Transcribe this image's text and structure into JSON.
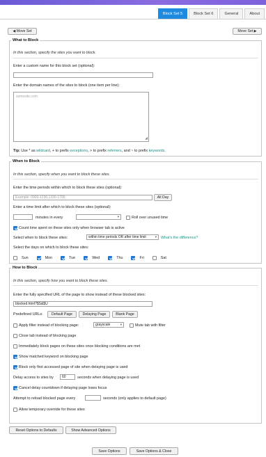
{
  "tabs": [
    "Block Set 5",
    "Block Set 6",
    "General",
    "About"
  ],
  "nav": {
    "move_left": "◀ Move Set",
    "move_right": "Move Set ▶"
  },
  "what": {
    "legend": "What to Block",
    "hint": "In this section, specify the sites you want to block.",
    "custom_name_label": "Enter a custom name for this block set (optional):",
    "custom_name_value": "",
    "domains_label": "Enter the domain names of the sites to block (one item per line):",
    "domains_placeholder": "somesite.com",
    "tip_pre": "Tip: Use * as ",
    "tip_wildcard": "wildcard",
    "tip_mid1": ", + to prefix ",
    "tip_exceptions": "exceptions",
    "tip_mid2": ", > to prefix ",
    "tip_referrers": "referrers",
    "tip_mid3": ", and ~ to prefix ",
    "tip_keywords": "keywords",
    "tip_end": "."
  },
  "when": {
    "legend": "When to Block",
    "hint": "In this section, specify when you want to block these sites.",
    "periods_label": "Enter the time periods within which to block these sites (optional):",
    "periods_placeholder": "Example: 0900-1230,1330-1700",
    "all_day": "All Day",
    "limit_label": "Enter a time limit after which to block these sites (optional):",
    "minutes_in_every": "minutes in every",
    "rollover": "Roll over unused time",
    "count_time": "Count time spent on these sites only when browser tab is active",
    "select_when_label": "Select when to block these sites:",
    "select_when_value": "within time periods OR after time limit",
    "whats_diff": "What's the difference?",
    "days_label": "Select the days on which to block these sites:",
    "days": [
      {
        "label": "Sun",
        "on": false
      },
      {
        "label": "Mon",
        "on": true
      },
      {
        "label": "Tue",
        "on": true
      },
      {
        "label": "Wed",
        "on": true
      },
      {
        "label": "Thu",
        "on": true
      },
      {
        "label": "Fri",
        "on": true
      },
      {
        "label": "Sat",
        "on": false
      }
    ]
  },
  "how": {
    "legend": "How to Block",
    "hint": "In this section, specify how you want to block these sites.",
    "url_label": "Enter the fully specified URL of the page to show instead of these blocked sites:",
    "url_value": "blocked.html?$S&$U",
    "predefined_label": "Predefined URLs:",
    "predefined": [
      "Default Page",
      "Delaying Page",
      "Blank Page"
    ],
    "apply_filter": "Apply filter instead of blocking page:",
    "filter_value": "grayscale",
    "mute_tab": "Mute tab with filter",
    "close_tab": "Close tab instead of blocking page",
    "immediately": "Immediately block pages on these sites once blocking conditions are met",
    "show_keyword": "Show matched keyword on blocking page",
    "block_first": "Block only first accessed page of site when delaying page is used",
    "delay_pre": "Delay access to sites by",
    "delay_value": "60",
    "delay_post": "seconds when delaying page is used",
    "cancel_delay": "Cancel delay countdown if delaying page loses focus",
    "reload_pre": "Attempt to reload blocked page every",
    "reload_post": "seconds (only applies to default page)",
    "allow_override": "Allow temporary override for these sites"
  },
  "footer": {
    "reset": "Reset Options to Defaults",
    "advanced": "Show Advanced Options",
    "save": "Save Options",
    "save_close": "Save Options & Close"
  }
}
